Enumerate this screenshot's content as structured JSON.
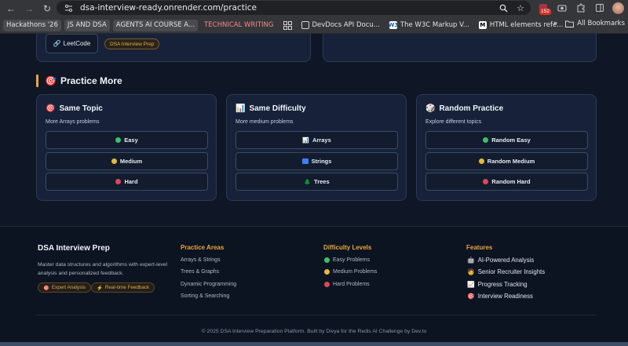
{
  "browser": {
    "url": "dsa-interview-ready.onrender.com/practice",
    "extension_badge": "152",
    "bookmarks": [
      {
        "label": "Hackathons '26",
        "style": "chip"
      },
      {
        "label": "JS AND DSA",
        "style": "chip"
      },
      {
        "label": "AGENTS AI COURSE A...",
        "style": "chip"
      },
      {
        "label": "TECHNICAL WRITING",
        "style": "accent"
      },
      {
        "label": "DevDocs API Docu...",
        "style": "plain"
      },
      {
        "label": "The W3C Markup V...",
        "style": "plain"
      },
      {
        "label": "HTML elements refe...",
        "style": "plain"
      }
    ],
    "all_bookmarks": "All Bookmarks"
  },
  "top_card": {
    "leetcode_label": "LeetCode",
    "badge": "DSA Interview Prep"
  },
  "practice_more": {
    "icon": "dart-icon",
    "title": "Practice More",
    "cards": [
      {
        "icon": "dart-icon",
        "title": "Same Topic",
        "subtitle": "More Arrays problems",
        "buttons": [
          {
            "label": "Easy",
            "icon": "green-dot",
            "color": "#3fbf6a"
          },
          {
            "label": "Medium",
            "icon": "yellow-dot",
            "color": "#e6b93a"
          },
          {
            "label": "Hard",
            "icon": "red-dot",
            "color": "#e0455a"
          }
        ]
      },
      {
        "icon": "bar-chart-icon",
        "title": "Same Difficulty",
        "subtitle": "More medium problems",
        "buttons": [
          {
            "label": "Arrays",
            "icon": "bar-chart-icon"
          },
          {
            "label": "Strings",
            "icon": "abc-icon"
          },
          {
            "label": "Trees",
            "icon": "tree-icon"
          }
        ]
      },
      {
        "icon": "dice-icon",
        "title": "Random Practice",
        "subtitle": "Explore different topics",
        "buttons": [
          {
            "label": "Random Easy",
            "icon": "green-dot",
            "color": "#3fbf6a"
          },
          {
            "label": "Random Medium",
            "icon": "yellow-dot",
            "color": "#e6b93a"
          },
          {
            "label": "Random Hard",
            "icon": "red-dot",
            "color": "#e0455a"
          }
        ]
      }
    ]
  },
  "footer": {
    "brand": "DSA Interview Prep",
    "description": "Master data structures and algorithms with expert-level analysis and personalized feedback.",
    "badges": [
      "Expert Analysis",
      "Real-time Feedback"
    ],
    "practice_areas": {
      "title": "Practice Areas",
      "links": [
        "Arrays & Strings",
        "Trees & Graphs",
        "Dynamic Programming",
        "Sorting & Searching"
      ]
    },
    "difficulty_levels": {
      "title": "Difficulty Levels",
      "links": [
        "Easy Problems",
        "Medium Problems",
        "Hard Problems"
      ]
    },
    "features": {
      "title": "Features",
      "items": [
        "AI-Powered Analysis",
        "Senior Recruiter Insights",
        "Progress Tracking",
        "Interview Readiness"
      ]
    },
    "copyright": "© 2025 DSA Interview Preparation Platform. Built by Divya for the Redis AI Challenge by Dev.to"
  },
  "colors": {
    "accent": "#e8a53a",
    "easy": "#3fbf6a",
    "medium": "#e6b93a",
    "hard": "#e0455a"
  }
}
